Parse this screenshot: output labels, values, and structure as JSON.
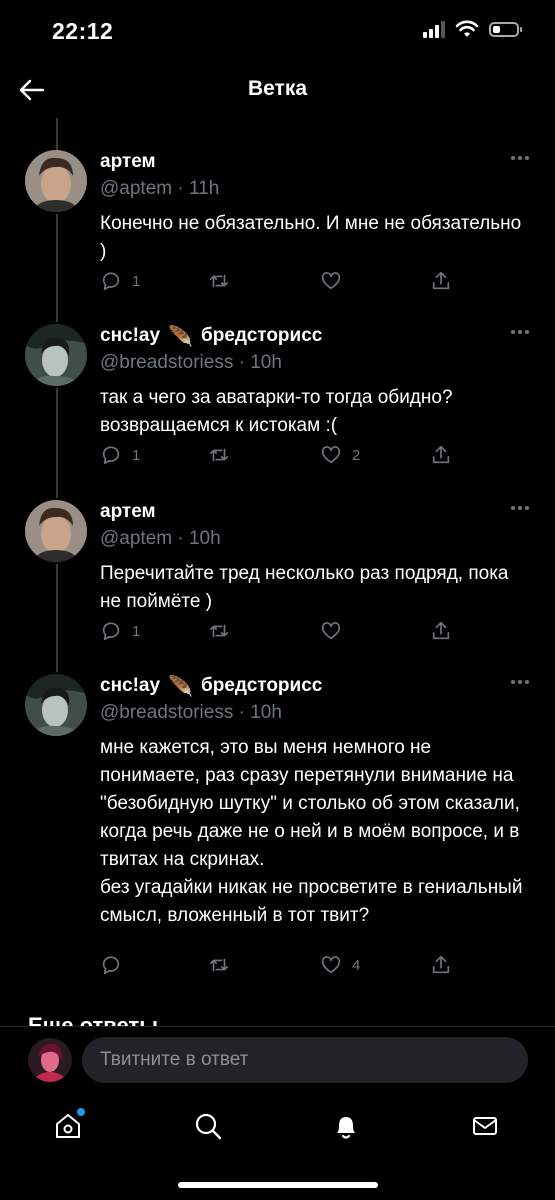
{
  "status_bar": {
    "time": "22:12"
  },
  "header": {
    "title": "Ветка"
  },
  "tweets": [
    {
      "author": "артем",
      "handle": "@aptem · 11h",
      "text": "Конечно не обязательно. И мне не обязательно )",
      "reply_count": "1",
      "retweet_count": "",
      "like_count": ""
    },
    {
      "author": "снс!ау",
      "author_suffix": "бредсторисс",
      "handle": "@breadstoriess · 10h",
      "text": "так а чего за аватарки-то тогда обидно? возвращаемся к истокам :(",
      "reply_count": "1",
      "retweet_count": "",
      "like_count": "2"
    },
    {
      "author": "артем",
      "handle": "@aptem · 10h",
      "text": "Перечитайте тред несколько раз подряд, пока не поймёте )",
      "reply_count": "1",
      "retweet_count": "",
      "like_count": ""
    },
    {
      "author": "снс!ау",
      "author_suffix": "бредсторисс",
      "handle": "@breadstoriess · 10h",
      "text": "мне кажется, это вы меня немного не понимаете, раз сразу перетянули внимание на \"безобидную шутку\" и столько об этом сказали, когда речь даже не о ней и в моём вопросе, и в твитах на скринах.\nбез угадайки никак не просветите в гениальный смысл, вложенный в тот твит?",
      "reply_count": "",
      "retweet_count": "",
      "like_count": "4"
    }
  ],
  "more_replies": "Еще ответы",
  "reply_bar": {
    "placeholder": "Твитните в ответ"
  },
  "colors": {
    "background": "#000000",
    "muted": "#6e767d",
    "accent": "#1d9bf0",
    "input_bg": "#202327"
  }
}
